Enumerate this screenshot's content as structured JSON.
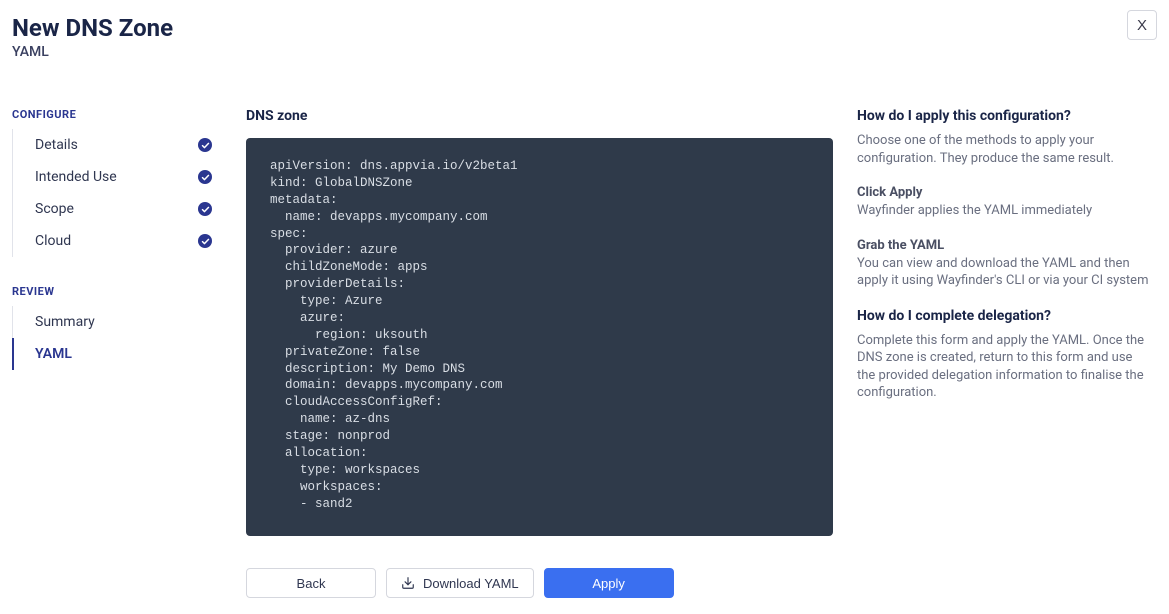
{
  "header": {
    "title": "New DNS Zone",
    "subtitle": "YAML",
    "close_label": "X"
  },
  "sidebar": {
    "section_configure": "CONFIGURE",
    "section_review": "REVIEW",
    "configure_items": [
      {
        "label": "Details",
        "done": true
      },
      {
        "label": "Intended Use",
        "done": true
      },
      {
        "label": "Scope",
        "done": true
      },
      {
        "label": "Cloud",
        "done": true
      }
    ],
    "review_items": [
      {
        "label": "Summary",
        "active": false
      },
      {
        "label": "YAML",
        "active": true
      }
    ]
  },
  "main": {
    "heading": "DNS zone",
    "yaml": "apiVersion: dns.appvia.io/v2beta1\nkind: GlobalDNSZone\nmetadata:\n  name: devapps.mycompany.com\nspec:\n  provider: azure\n  childZoneMode: apps\n  providerDetails:\n    type: Azure\n    azure:\n      region: uksouth\n  privateZone: false\n  description: My Demo DNS\n  domain: devapps.mycompany.com\n  cloudAccessConfigRef:\n    name: az-dns\n  stage: nonprod\n  allocation:\n    type: workspaces\n    workspaces:\n    - sand2",
    "buttons": {
      "back": "Back",
      "download": "Download YAML",
      "apply": "Apply"
    }
  },
  "help": {
    "q1": "How do I apply this configuration?",
    "q1_text": "Choose one of the methods to apply your configuration. They produce the same result.",
    "click_apply_heading": "Click Apply",
    "click_apply_text": "Wayfinder applies the YAML immediately",
    "grab_yaml_heading": "Grab the YAML",
    "grab_yaml_text": "You can view and download the YAML and then apply it using Wayfinder's CLI or via your CI system",
    "q2": "How do I complete delegation?",
    "q2_text": "Complete this form and apply the YAML. Once the DNS zone is created, return to this form and use the provided delegation information to finalise the configuration."
  }
}
